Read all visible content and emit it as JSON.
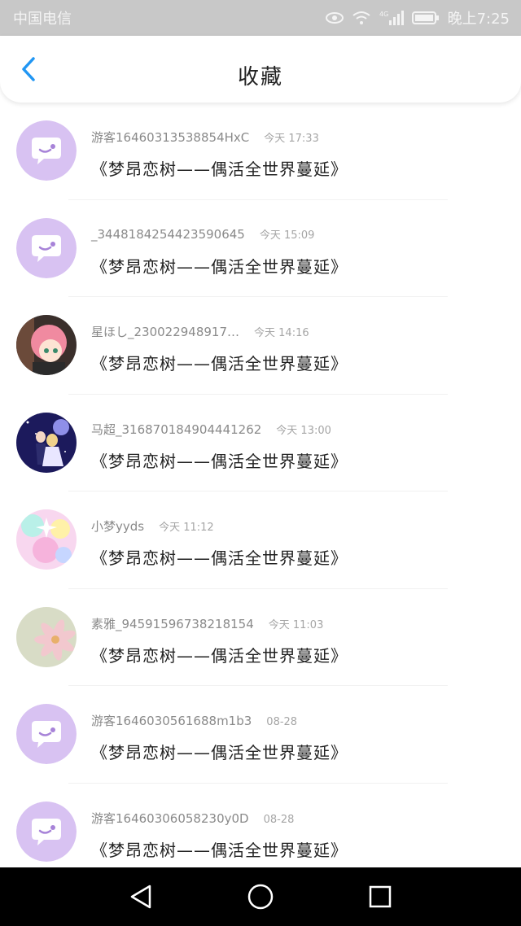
{
  "status_bar": {
    "carrier": "中国电信",
    "time": "晚上7:25",
    "network": "4G",
    "icons": [
      "eye-icon",
      "wifi-icon",
      "signal-icon",
      "battery-icon"
    ]
  },
  "header": {
    "title": "收藏",
    "back_icon": "chevron-left-icon",
    "accent_color": "#2196f3"
  },
  "items": [
    {
      "username": "游客16460313538854HxC",
      "time": "今天 17:33",
      "message": "《梦昂恋树——偶活全世界蔓延》",
      "avatar": "default-chat-avatar"
    },
    {
      "username": "_3448184254423590645",
      "time": "今天 15:09",
      "message": "《梦昂恋树——偶活全世界蔓延》",
      "avatar": "default-chat-avatar"
    },
    {
      "username": "星ほし_230022948917…",
      "time": "今天 14:16",
      "message": "《梦昂恋树——偶活全世界蔓延》",
      "avatar": "anime-girl-pink-hair"
    },
    {
      "username": "马超_316870184904441262",
      "time": "今天 13:00",
      "message": "《梦昂恋树——偶活全世界蔓延》",
      "avatar": "anime-couple-night"
    },
    {
      "username": "小梦yyds",
      "time": "今天 11:12",
      "message": "《梦昂恋树——偶活全世界蔓延》",
      "avatar": "pastel-sparkle"
    },
    {
      "username": "素雅_94591596738218154",
      "time": "今天 11:03",
      "message": "《梦昂恋树——偶活全世界蔓延》",
      "avatar": "pink-flower"
    },
    {
      "username": "游客1646030561688m1b3",
      "time": "08-28",
      "message": "《梦昂恋树——偶活全世界蔓延》",
      "avatar": "default-chat-avatar"
    },
    {
      "username": "游客16460306058230y0D",
      "time": "08-28",
      "message": "《梦昂恋树——偶活全世界蔓延》",
      "avatar": "default-chat-avatar"
    }
  ],
  "nav": {
    "back": "triangle-back-icon",
    "home": "circle-home-icon",
    "recent": "square-recent-icon"
  }
}
